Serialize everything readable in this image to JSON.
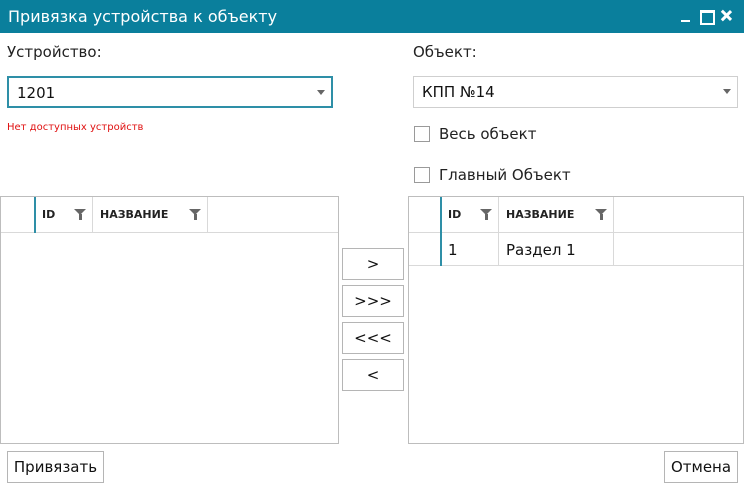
{
  "window": {
    "title": "Привязка устройства к объекту"
  },
  "device": {
    "label": "Устройство:",
    "value": "1201",
    "error": "Нет доступных устройств"
  },
  "object": {
    "label": "Объект:",
    "value": "КПП №14",
    "whole_object_label": "Весь объект",
    "main_object_label": "Главный Объект"
  },
  "left_grid": {
    "columns": {
      "id": "ID",
      "name": "НАЗВАНИЕ"
    },
    "rows": []
  },
  "right_grid": {
    "columns": {
      "id": "ID",
      "name": "НАЗВАНИЕ"
    },
    "rows": [
      {
        "id": "1",
        "name": "Раздел 1"
      }
    ]
  },
  "transfer_buttons": {
    "move_one_right": ">",
    "move_all_right": ">>>",
    "move_all_left": "<<<",
    "move_one_left": "<"
  },
  "footer": {
    "bind_label": "Привязать",
    "cancel_label": "Отмена"
  },
  "colors": {
    "titlebar": "#0a7f9c",
    "accent": "#2e8fa7",
    "error": "#e01010"
  }
}
